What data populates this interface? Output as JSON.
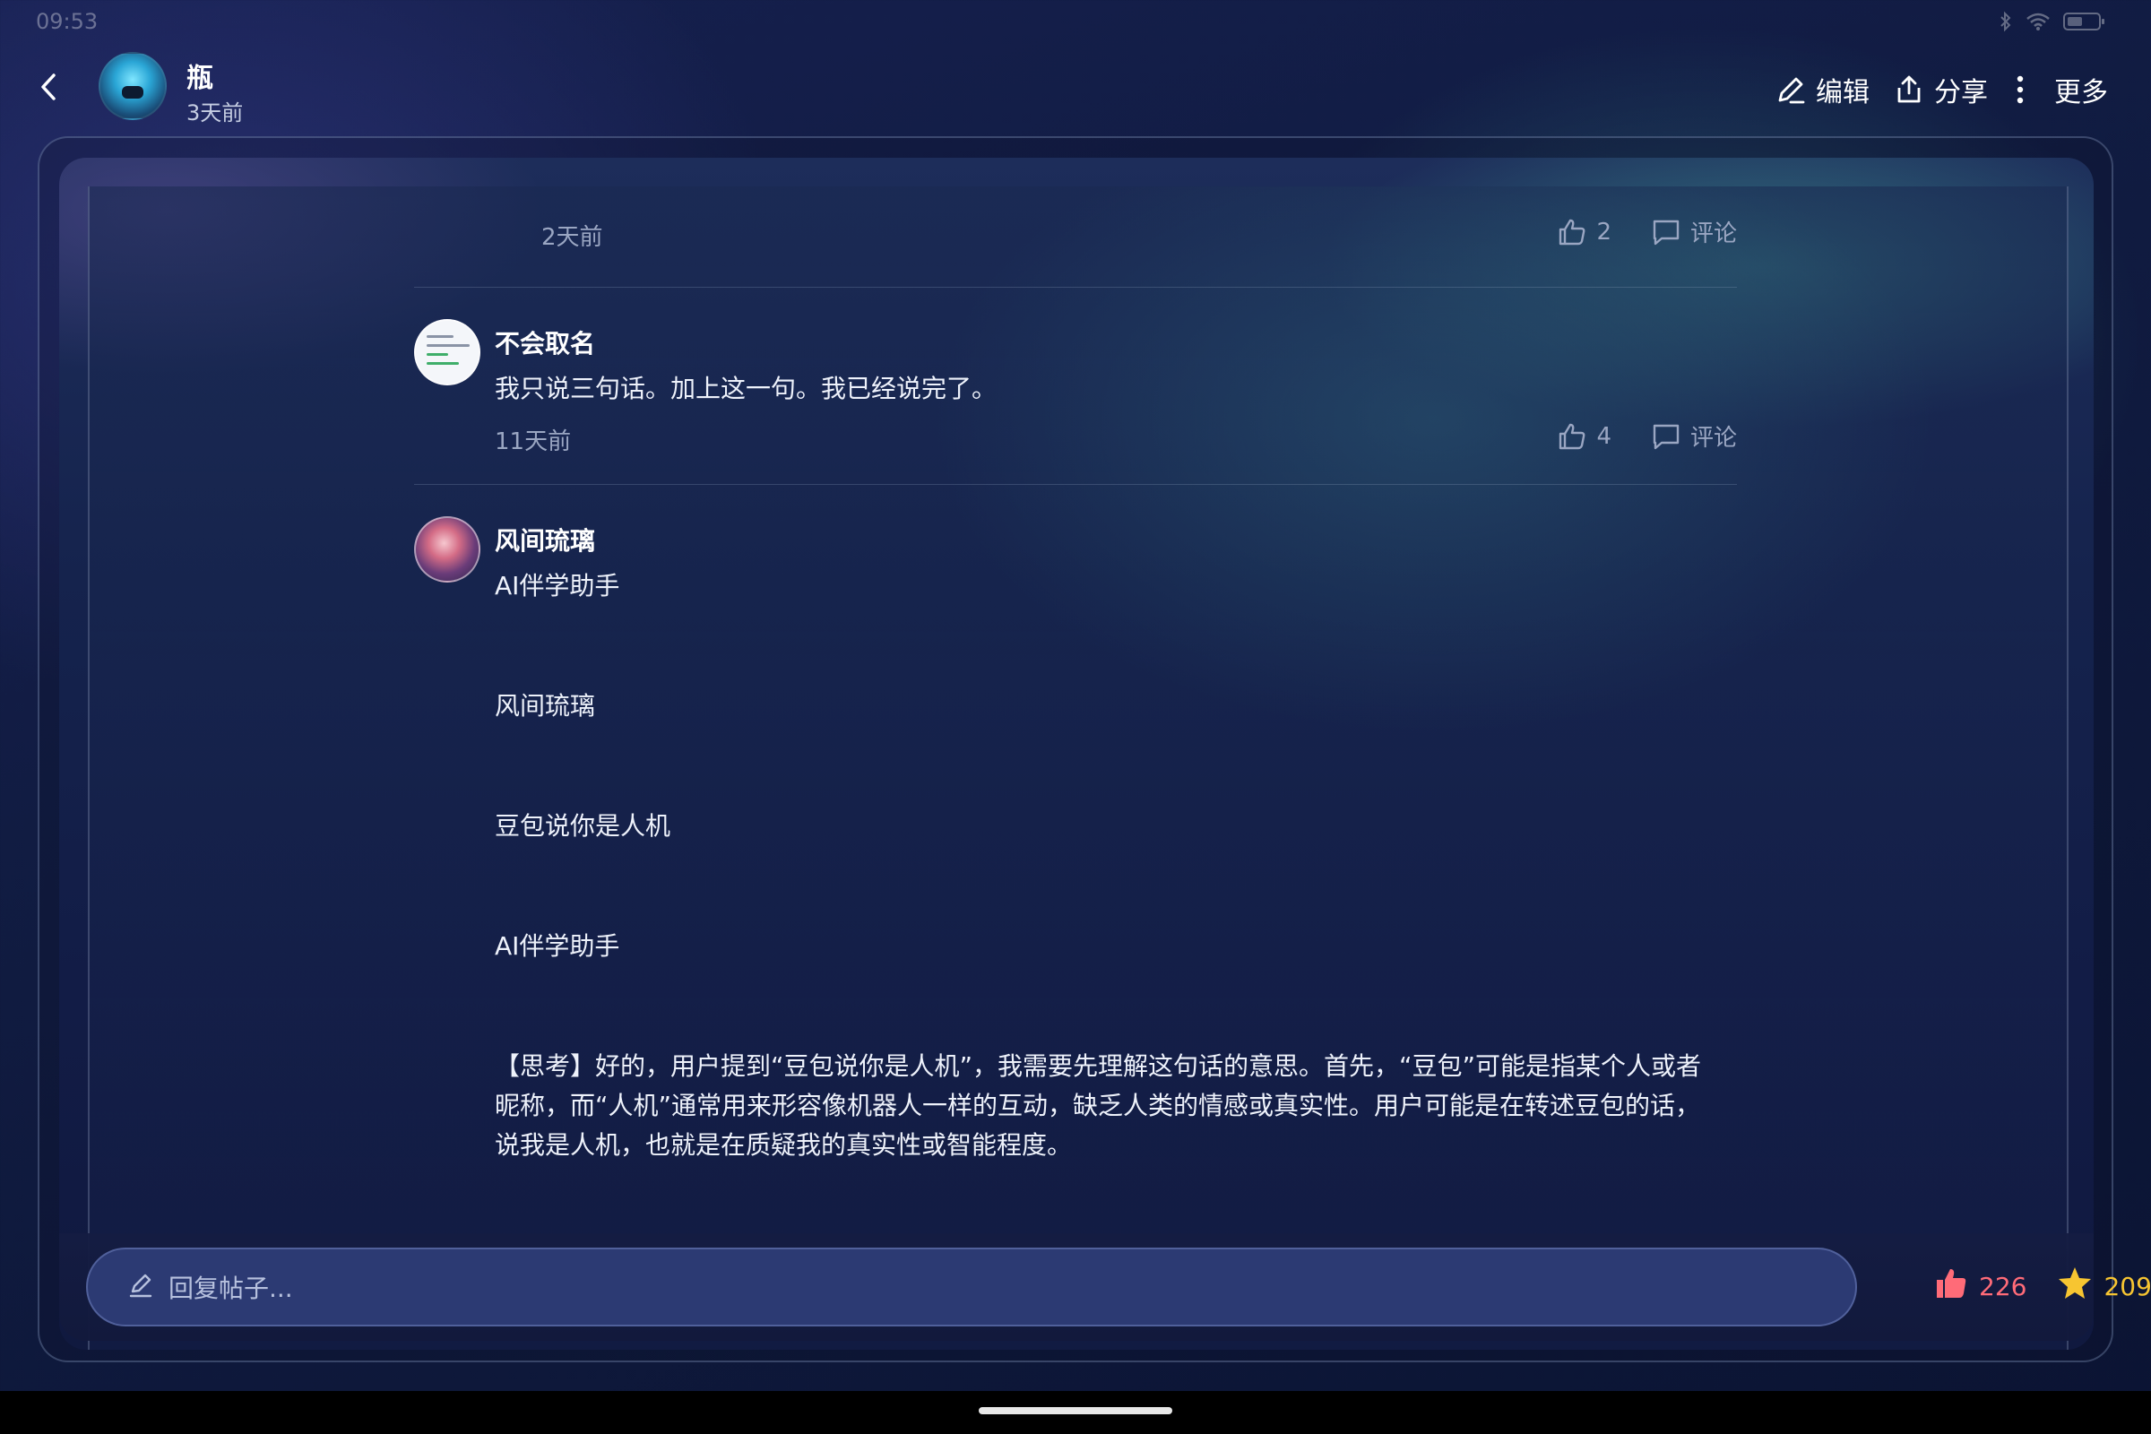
{
  "status": {
    "time": "09:53",
    "icons": [
      "bluetooth-icon",
      "wifi-icon",
      "battery-icon"
    ]
  },
  "post_author": {
    "name": "瓶",
    "time": "3天前"
  },
  "actions": {
    "edit": "编辑",
    "share": "分享",
    "more": "更多"
  },
  "comments": [
    {
      "time": "2天前",
      "likes": "2",
      "comment_label": "评论"
    },
    {
      "name": "不会取名",
      "text": "我只说三句话。加上这一句。我已经说完了。",
      "time": "11天前",
      "likes": "4",
      "comment_label": "评论"
    },
    {
      "name": "风间琉璃",
      "paragraphs": [
        "AI伴学助手",
        "风间琉璃",
        "豆包说你是人机",
        "AI伴学助手",
        "【思考】好的，用户提到“豆包说你是人机”，我需要先理解这句话的意思。首先，“豆包”可能是指某个人或者",
        "昵称，而“人机”通常用来形容像机器人一样的互动，缺乏人类的情感或真实性。用户可能是在转述豆包的话，",
        "说我是人机，也就是在质疑我的真实性或智能程度。"
      ]
    }
  ],
  "reply": {
    "placeholder": "回复帖子...",
    "likes": "226",
    "favorites": "209"
  },
  "colors": {
    "like": "#ff6b78",
    "favorite": "#f7c531",
    "accent_teal": "#3aa8a0"
  }
}
